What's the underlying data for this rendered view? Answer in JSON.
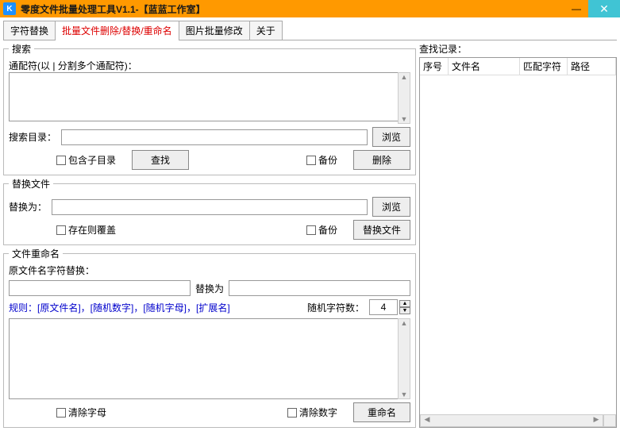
{
  "window": {
    "logo": "K",
    "title": "零度文件批量处理工具V1.1-【蓝蓝工作室】"
  },
  "tabs": {
    "t1": "字符替换",
    "t2": "批量文件删除/替换/重命名",
    "t3": "图片批量修改",
    "t4": "关于"
  },
  "search": {
    "legend": "搜索",
    "wildcard_label": "通配符(以 | 分割多个通配符)：",
    "wildcard_value": "",
    "dir_label": "搜索目录：",
    "dir_value": "",
    "browse": "浏览",
    "include_sub": "包含子目录",
    "find": "查找",
    "backup": "备份",
    "delete": "删除"
  },
  "replace": {
    "legend": "替换文件",
    "to_label": "替换为：",
    "to_value": "",
    "browse": "浏览",
    "overwrite": "存在则覆盖",
    "backup": "备份",
    "do": "替换文件"
  },
  "rename": {
    "legend": "文件重命名",
    "orig_label": "原文件名字符替换：",
    "from_value": "",
    "to_label": "替换为",
    "to_value": "",
    "rule_label": "规则：[原文件名]，[随机数字]，[随机字母]，[扩展名]",
    "rand_label": "随机字符数：",
    "rand_value": "4",
    "rule_value": "",
    "clear_alpha": "清除字母",
    "clear_digit": "清除数字",
    "do": "重命名"
  },
  "results": {
    "label": "查找记录：",
    "h1": "序号",
    "h2": "文件名",
    "h3": "匹配字符",
    "h4": "路径"
  }
}
